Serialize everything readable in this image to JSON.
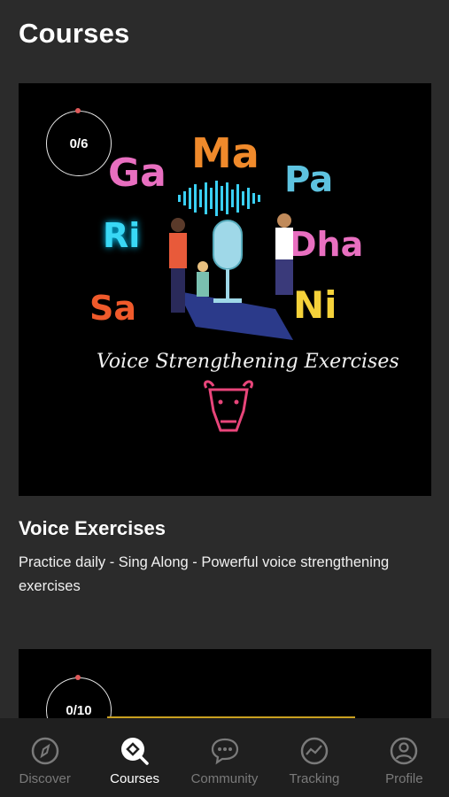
{
  "header": {
    "title": "Courses"
  },
  "courses": [
    {
      "progress": "0/6",
      "art": {
        "letters": [
          "Ga",
          "Ma",
          "Pa",
          "Ri",
          "Dha",
          "Sa",
          "Ni"
        ],
        "caption": "Voice Strengthening Exercises"
      },
      "title": "Voice Exercises",
      "description": "Practice daily - Sing Along - Powerful voice strengthening exercises"
    },
    {
      "progress": "0/10"
    }
  ],
  "bottom_nav": {
    "active": "Courses",
    "items": [
      {
        "label": "Discover",
        "icon": "compass-icon"
      },
      {
        "label": "Courses",
        "icon": "courses-search-icon"
      },
      {
        "label": "Community",
        "icon": "chat-bubble-icon"
      },
      {
        "label": "Tracking",
        "icon": "tracking-chart-icon"
      },
      {
        "label": "Profile",
        "icon": "profile-icon"
      }
    ]
  }
}
